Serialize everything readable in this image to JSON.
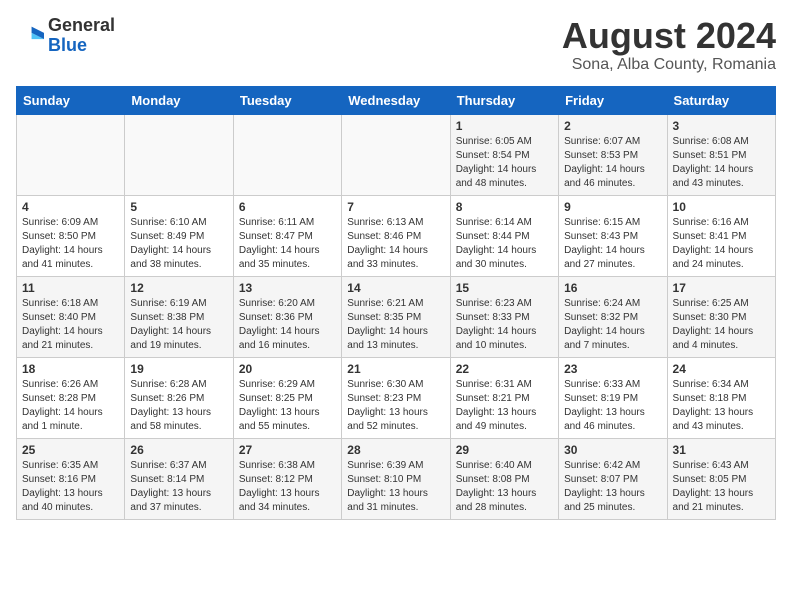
{
  "logo": {
    "general": "General",
    "blue": "Blue"
  },
  "title": "August 2024",
  "subtitle": "Sona, Alba County, Romania",
  "weekdays": [
    "Sunday",
    "Monday",
    "Tuesday",
    "Wednesday",
    "Thursday",
    "Friday",
    "Saturday"
  ],
  "weeks": [
    [
      {
        "day": "",
        "info": ""
      },
      {
        "day": "",
        "info": ""
      },
      {
        "day": "",
        "info": ""
      },
      {
        "day": "",
        "info": ""
      },
      {
        "day": "1",
        "info": "Sunrise: 6:05 AM\nSunset: 8:54 PM\nDaylight: 14 hours\nand 48 minutes."
      },
      {
        "day": "2",
        "info": "Sunrise: 6:07 AM\nSunset: 8:53 PM\nDaylight: 14 hours\nand 46 minutes."
      },
      {
        "day": "3",
        "info": "Sunrise: 6:08 AM\nSunset: 8:51 PM\nDaylight: 14 hours\nand 43 minutes."
      }
    ],
    [
      {
        "day": "4",
        "info": "Sunrise: 6:09 AM\nSunset: 8:50 PM\nDaylight: 14 hours\nand 41 minutes."
      },
      {
        "day": "5",
        "info": "Sunrise: 6:10 AM\nSunset: 8:49 PM\nDaylight: 14 hours\nand 38 minutes."
      },
      {
        "day": "6",
        "info": "Sunrise: 6:11 AM\nSunset: 8:47 PM\nDaylight: 14 hours\nand 35 minutes."
      },
      {
        "day": "7",
        "info": "Sunrise: 6:13 AM\nSunset: 8:46 PM\nDaylight: 14 hours\nand 33 minutes."
      },
      {
        "day": "8",
        "info": "Sunrise: 6:14 AM\nSunset: 8:44 PM\nDaylight: 14 hours\nand 30 minutes."
      },
      {
        "day": "9",
        "info": "Sunrise: 6:15 AM\nSunset: 8:43 PM\nDaylight: 14 hours\nand 27 minutes."
      },
      {
        "day": "10",
        "info": "Sunrise: 6:16 AM\nSunset: 8:41 PM\nDaylight: 14 hours\nand 24 minutes."
      }
    ],
    [
      {
        "day": "11",
        "info": "Sunrise: 6:18 AM\nSunset: 8:40 PM\nDaylight: 14 hours\nand 21 minutes."
      },
      {
        "day": "12",
        "info": "Sunrise: 6:19 AM\nSunset: 8:38 PM\nDaylight: 14 hours\nand 19 minutes."
      },
      {
        "day": "13",
        "info": "Sunrise: 6:20 AM\nSunset: 8:36 PM\nDaylight: 14 hours\nand 16 minutes."
      },
      {
        "day": "14",
        "info": "Sunrise: 6:21 AM\nSunset: 8:35 PM\nDaylight: 14 hours\nand 13 minutes."
      },
      {
        "day": "15",
        "info": "Sunrise: 6:23 AM\nSunset: 8:33 PM\nDaylight: 14 hours\nand 10 minutes."
      },
      {
        "day": "16",
        "info": "Sunrise: 6:24 AM\nSunset: 8:32 PM\nDaylight: 14 hours\nand 7 minutes."
      },
      {
        "day": "17",
        "info": "Sunrise: 6:25 AM\nSunset: 8:30 PM\nDaylight: 14 hours\nand 4 minutes."
      }
    ],
    [
      {
        "day": "18",
        "info": "Sunrise: 6:26 AM\nSunset: 8:28 PM\nDaylight: 14 hours\nand 1 minute."
      },
      {
        "day": "19",
        "info": "Sunrise: 6:28 AM\nSunset: 8:26 PM\nDaylight: 13 hours\nand 58 minutes."
      },
      {
        "day": "20",
        "info": "Sunrise: 6:29 AM\nSunset: 8:25 PM\nDaylight: 13 hours\nand 55 minutes."
      },
      {
        "day": "21",
        "info": "Sunrise: 6:30 AM\nSunset: 8:23 PM\nDaylight: 13 hours\nand 52 minutes."
      },
      {
        "day": "22",
        "info": "Sunrise: 6:31 AM\nSunset: 8:21 PM\nDaylight: 13 hours\nand 49 minutes."
      },
      {
        "day": "23",
        "info": "Sunrise: 6:33 AM\nSunset: 8:19 PM\nDaylight: 13 hours\nand 46 minutes."
      },
      {
        "day": "24",
        "info": "Sunrise: 6:34 AM\nSunset: 8:18 PM\nDaylight: 13 hours\nand 43 minutes."
      }
    ],
    [
      {
        "day": "25",
        "info": "Sunrise: 6:35 AM\nSunset: 8:16 PM\nDaylight: 13 hours\nand 40 minutes."
      },
      {
        "day": "26",
        "info": "Sunrise: 6:37 AM\nSunset: 8:14 PM\nDaylight: 13 hours\nand 37 minutes."
      },
      {
        "day": "27",
        "info": "Sunrise: 6:38 AM\nSunset: 8:12 PM\nDaylight: 13 hours\nand 34 minutes."
      },
      {
        "day": "28",
        "info": "Sunrise: 6:39 AM\nSunset: 8:10 PM\nDaylight: 13 hours\nand 31 minutes."
      },
      {
        "day": "29",
        "info": "Sunrise: 6:40 AM\nSunset: 8:08 PM\nDaylight: 13 hours\nand 28 minutes."
      },
      {
        "day": "30",
        "info": "Sunrise: 6:42 AM\nSunset: 8:07 PM\nDaylight: 13 hours\nand 25 minutes."
      },
      {
        "day": "31",
        "info": "Sunrise: 6:43 AM\nSunset: 8:05 PM\nDaylight: 13 hours\nand 21 minutes."
      }
    ]
  ]
}
